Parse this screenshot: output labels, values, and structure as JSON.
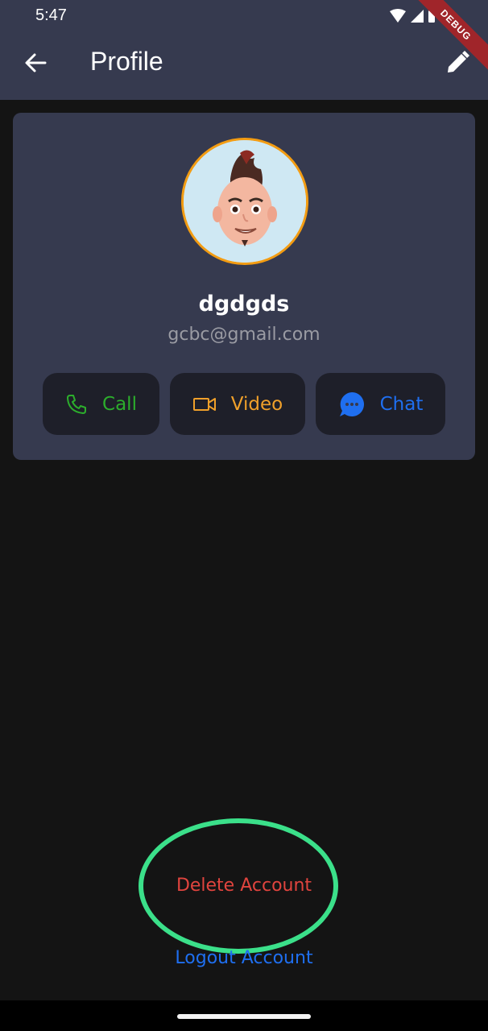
{
  "status_bar": {
    "time": "5:47",
    "debug_label": "DEBUG"
  },
  "app_bar": {
    "title": "Profile"
  },
  "profile": {
    "name": "dgdgds",
    "email": "gcbc@gmail.com"
  },
  "actions": [
    {
      "label": "Call",
      "icon": "phone-icon",
      "color": "#2cae2c"
    },
    {
      "label": "Video",
      "icon": "video-camera-icon",
      "color": "#f0a02a"
    },
    {
      "label": "Chat",
      "icon": "chat-bubble-icon",
      "color": "#1f6ff0"
    }
  ],
  "account": {
    "delete_label": "Delete Account",
    "logout_label": "Logout Account"
  },
  "colors": {
    "app_bar_bg": "#363a4f",
    "background": "#141414",
    "avatar_ring": "#f39c12",
    "delete_red": "#e0443e",
    "annotation_green": "#3be08a"
  }
}
